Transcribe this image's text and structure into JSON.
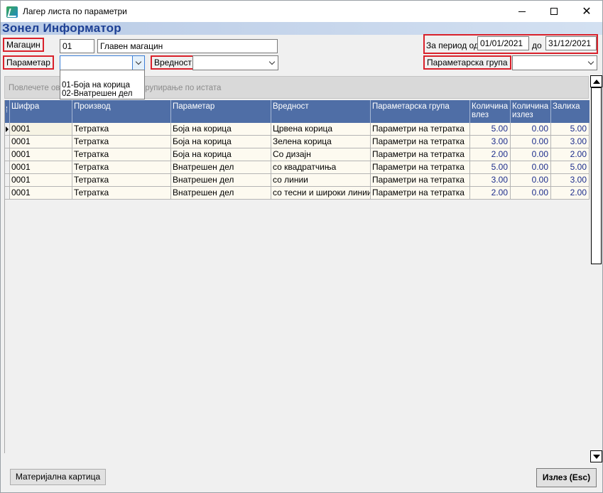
{
  "window": {
    "title": "Лагер листа по параметри",
    "controls": {
      "minimize": "minimize",
      "maximize": "maximize",
      "close": "✕"
    }
  },
  "brand": "Зонел Информатор",
  "filters": {
    "warehouse_label": "Магацин",
    "warehouse_code": "01",
    "warehouse_name": "Главен магацин",
    "period_from_label": "За период од",
    "period_from": "01/01/2021",
    "period_to_label": "до",
    "period_to": "31/12/2021",
    "parameter_label": "Параметар",
    "parameter_value": "",
    "value_label": "Вредност",
    "value_value": "",
    "param_group_label": "Параметарска група",
    "param_group_value": ""
  },
  "parameter_dropdown": {
    "options": [
      "01-Боја на корица",
      "02-Внатрешен дел"
    ]
  },
  "group_panel": {
    "hint_left": "Повлечете ов",
    "hint_right": "групирање по истата"
  },
  "grid": {
    "columns": [
      "Шифра",
      "Производ",
      "Параметар",
      "Вредност",
      "Параметарска група",
      "Количина влез",
      "Количина излез",
      "Залиха"
    ],
    "rows": [
      {
        "code": "0001",
        "product": "Тетратка",
        "parameter": "Боја на корица",
        "value": "Црвена корица",
        "group": "Параметри на тетратка",
        "qty_in": "5.00",
        "qty_out": "0.00",
        "stock": "5.00"
      },
      {
        "code": "0001",
        "product": "Тетратка",
        "parameter": "Боја на корица",
        "value": "Зелена корица",
        "group": "Параметри на тетратка",
        "qty_in": "3.00",
        "qty_out": "0.00",
        "stock": "3.00"
      },
      {
        "code": "0001",
        "product": "Тетратка",
        "parameter": "Боја на корица",
        "value": "Со дизајн",
        "group": "Параметри на тетратка",
        "qty_in": "2.00",
        "qty_out": "0.00",
        "stock": "2.00"
      },
      {
        "code": "0001",
        "product": "Тетратка",
        "parameter": "Внатрешен дел",
        "value": "со квадратчиња",
        "group": "Параметри на тетратка",
        "qty_in": "5.00",
        "qty_out": "0.00",
        "stock": "5.00"
      },
      {
        "code": "0001",
        "product": "Тетратка",
        "parameter": "Внатрешен дел",
        "value": "со линии",
        "group": "Параметри на тетратка",
        "qty_in": "3.00",
        "qty_out": "0.00",
        "stock": "3.00"
      },
      {
        "code": "0001",
        "product": "Тетратка",
        "parameter": "Внатрешен дел",
        "value": "со тесни и широки линии",
        "group": "Параметри на тетратка",
        "qty_in": "2.00",
        "qty_out": "0.00",
        "stock": "2.00"
      }
    ]
  },
  "buttons": {
    "material_card": "Материјална картица",
    "exit": "Излез (Esc)"
  },
  "colors": {
    "header_bg": "#4f6ea6",
    "brand_text": "#1c3f94",
    "highlight_border": "#d9212b",
    "number_text": "#1c2d8c",
    "row_bg": "#fdfaf0"
  }
}
